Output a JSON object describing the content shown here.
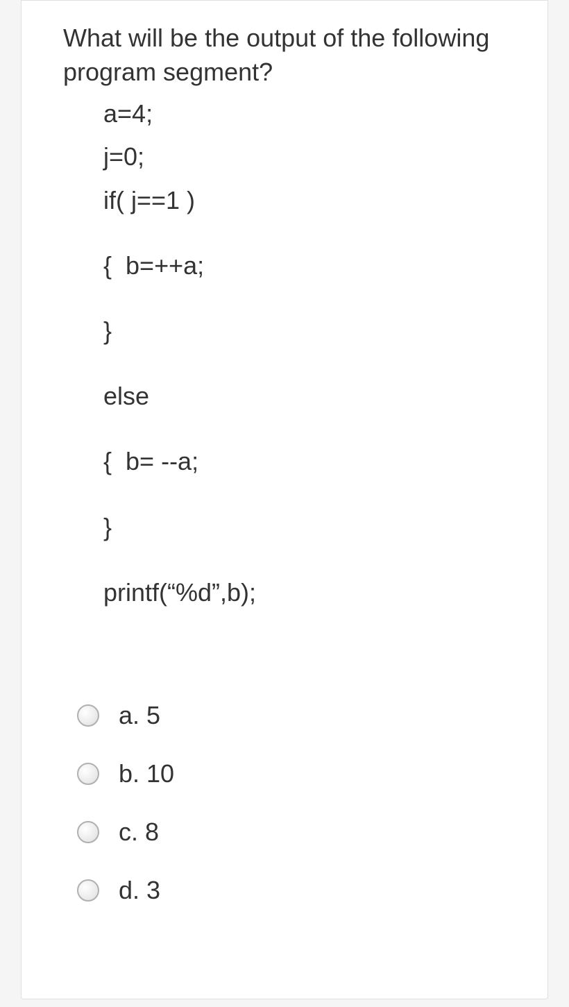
{
  "question": "What will be the output of the following program segment?",
  "code": {
    "l1": "a=4;",
    "l2": "j=0;",
    "l3": "if( j==1 )",
    "l4": "{  b=++a;",
    "l5": "}",
    "l6": "else",
    "l7": "{  b= --a;",
    "l8": "}",
    "l9": "printf(“%d”,b);"
  },
  "options": [
    {
      "label": "a. 5"
    },
    {
      "label": "b. 10"
    },
    {
      "label": "c. 8"
    },
    {
      "label": "d. 3"
    }
  ]
}
